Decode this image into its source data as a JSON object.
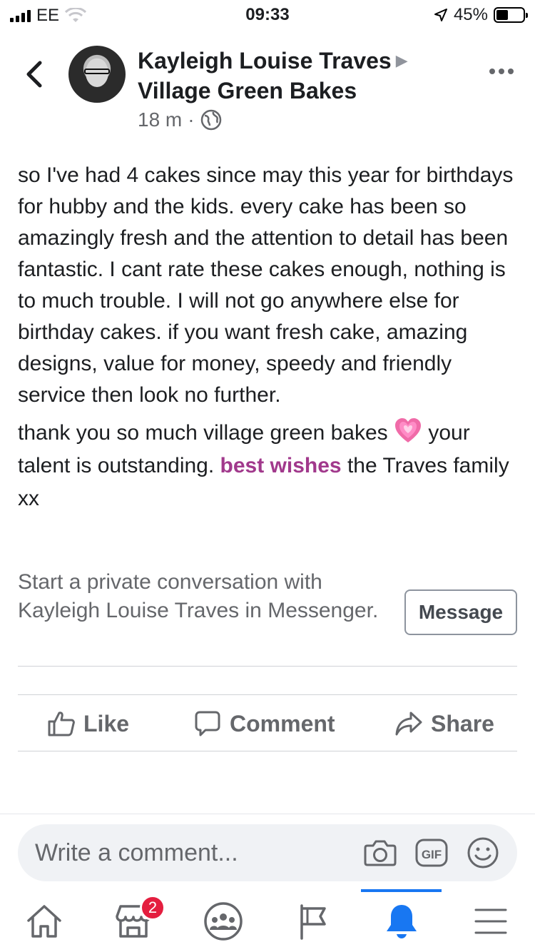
{
  "status_bar": {
    "carrier": "EE",
    "time": "09:33",
    "battery": "45%",
    "battery_level": 0.45
  },
  "post": {
    "author": "Kayleigh Louise Traves",
    "page": "Village Green Bakes",
    "time_ago": "18 m",
    "separator": "·",
    "paragraph1": "so I've had 4 cakes since may this year for birthdays for hubby and the kids. every cake has been so amazingly fresh and the attention to  detail has been fantastic. I cant rate these cakes enough, nothing is to much trouble. I will not go anywhere else for birthday cakes. if you want fresh cake, amazing designs, value for money, speedy and friendly service then look no further.",
    "paragraph2_part1": "thank you so much village green bakes ",
    "paragraph2_part2": " your talent is outstanding. ",
    "highlight": "best wishes",
    "paragraph2_part3": " the Traves family xx"
  },
  "private_conversation": {
    "text": "Start a private conversation with Kayleigh Louise Traves in Messenger.",
    "button": "Message"
  },
  "actions": {
    "like": "Like",
    "comment": "Comment",
    "share": "Share"
  },
  "composer": {
    "placeholder": "Write a comment..."
  },
  "tabbar": {
    "marketplace_badge": "2",
    "active_tab": "notifications",
    "accent": "#1877f2"
  },
  "colors": {
    "highlight": "#a1398c",
    "badge": "#e41e3f"
  }
}
